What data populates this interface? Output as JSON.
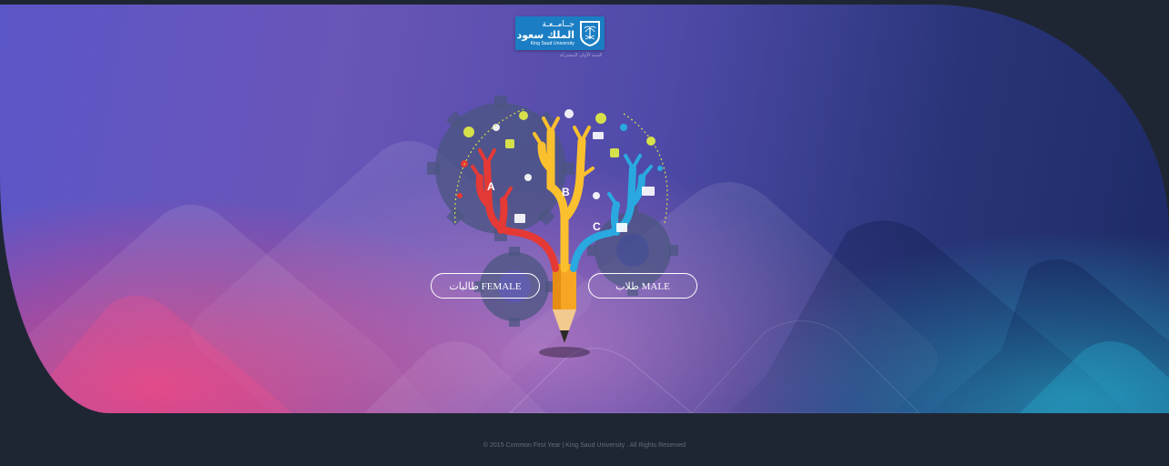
{
  "logo": {
    "arabic_line1": "جــامــعـة",
    "arabic_line2": "الملك سعود",
    "english": "King Saud University",
    "emblem": "ksu-palm-emblem-icon",
    "subtitle": "السنة الأولى المشتركة"
  },
  "illustration": {
    "letters": [
      "A",
      "B",
      "C"
    ],
    "icon": "pencil-knowledge-tree-icon"
  },
  "buttons": {
    "female_label": "طالبات FEMALE",
    "male_label": "طلاب MALE"
  },
  "footer": {
    "copyright": "© 2015 Common First Year | King Saud University . All Rights Reserved"
  },
  "colors": {
    "logo_blue": "#1b7ec4",
    "branch_red": "#e53935",
    "branch_yellow": "#fbc02d",
    "branch_blue": "#29a9e0",
    "footer_bg": "#1f2633"
  }
}
